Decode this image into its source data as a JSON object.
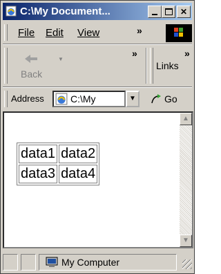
{
  "window": {
    "title": "C:\\My Document...",
    "minimize_icon": "minimize-icon",
    "maximize_icon": "maximize-icon",
    "close_icon": "close-icon"
  },
  "menu": {
    "items": [
      "File",
      "Edit",
      "View"
    ],
    "more": "»"
  },
  "toolbar": {
    "back_label": "Back",
    "more": "»",
    "links_label": "Links",
    "links_more": "»"
  },
  "address": {
    "label": "Address",
    "value": "C:\\My",
    "go_label": "Go"
  },
  "table": {
    "rows": [
      [
        "data1",
        "data2"
      ],
      [
        "data3",
        "data4"
      ]
    ]
  },
  "status": {
    "zone_text": "My Computer"
  },
  "colors": {
    "titlebar_start": "#0a246a",
    "titlebar_end": "#a6caf0",
    "face": "#d4d0c8"
  }
}
